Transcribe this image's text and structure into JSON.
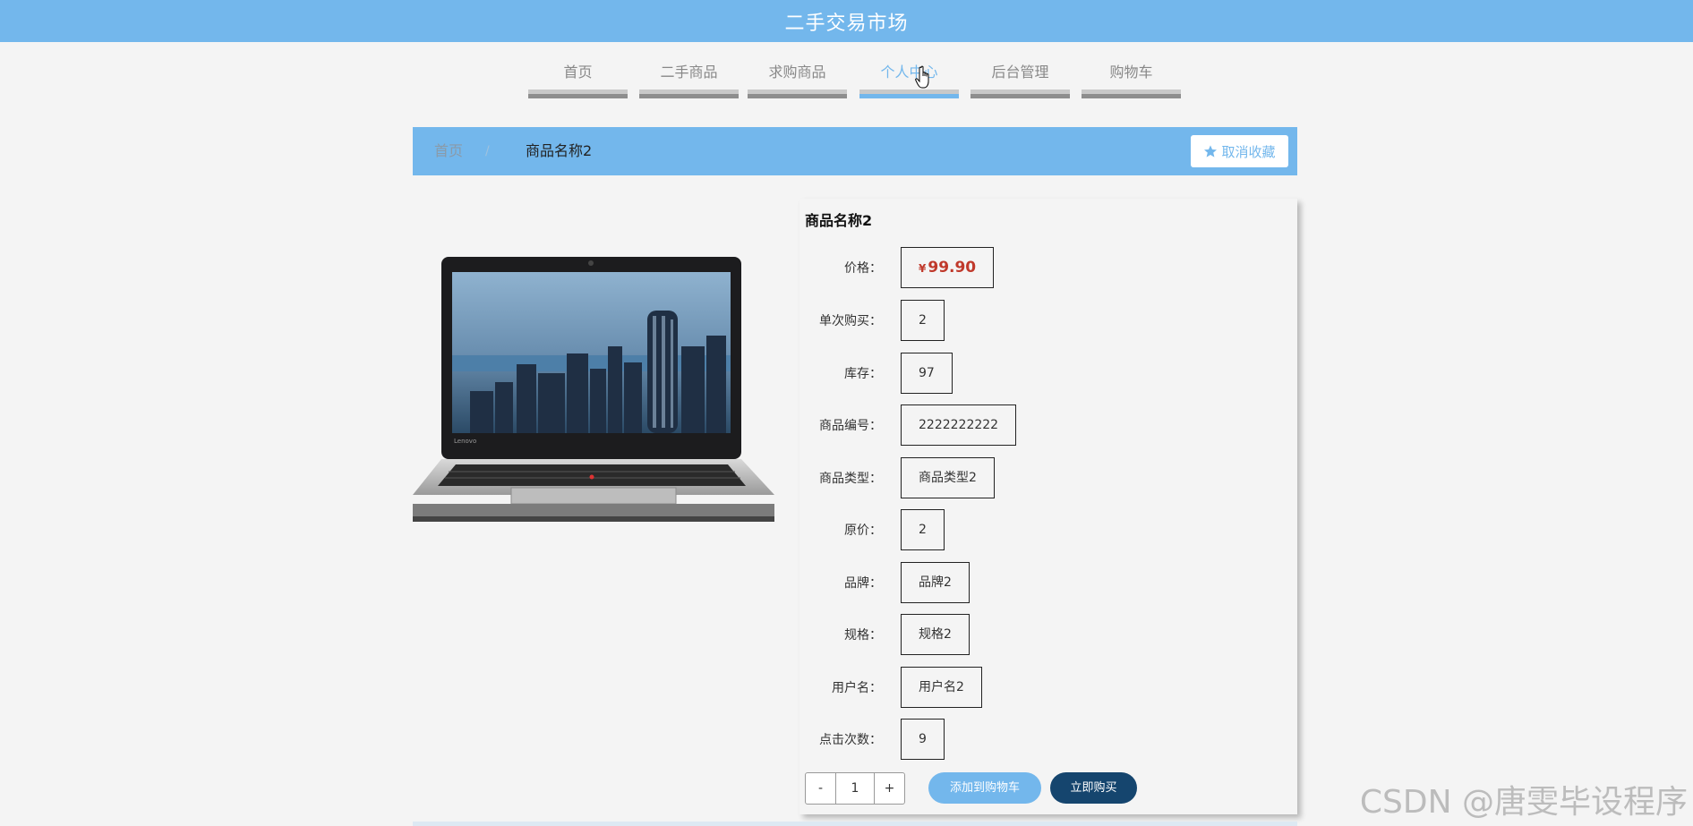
{
  "header": {
    "title": "二手交易市场"
  },
  "nav": {
    "items": [
      {
        "label": "首页",
        "active": false
      },
      {
        "label": "二手商品",
        "active": false
      },
      {
        "label": "求购商品",
        "active": false
      },
      {
        "label": "个人中心",
        "active": true
      },
      {
        "label": "后台管理",
        "active": false
      },
      {
        "label": "购物车",
        "active": false
      }
    ]
  },
  "breadcrumb": {
    "home": "首页",
    "separator": "/",
    "current": "商品名称2",
    "favorite_button": "取消收藏",
    "favorite_icon": "star-icon"
  },
  "product": {
    "name": "商品名称2",
    "image_alt": "laptop-image",
    "currency_symbol": "¥",
    "fields": [
      {
        "label": "价格：",
        "value": "99.90"
      },
      {
        "label": "单次购买：",
        "value": "2"
      },
      {
        "label": "库存：",
        "value": "97"
      },
      {
        "label": "商品编号：",
        "value": "2222222222"
      },
      {
        "label": "商品类型：",
        "value": "商品类型2"
      },
      {
        "label": "原价：",
        "value": "2"
      },
      {
        "label": "品牌：",
        "value": "品牌2"
      },
      {
        "label": "规格：",
        "value": "规格2"
      },
      {
        "label": "用户名：",
        "value": "用户名2"
      },
      {
        "label": "点击次数：",
        "value": "9"
      }
    ]
  },
  "purchase": {
    "minus_label": "-",
    "plus_label": "+",
    "quantity": "1",
    "add_to_cart_label": "添加到购物车",
    "buy_now_label": "立即购买"
  },
  "watermark": "CSDN @唐雯毕设程序",
  "colors": {
    "primary": "#73b7ec",
    "dark_button": "#15456e",
    "price": "#c0392b",
    "background": "#f4f4f4"
  }
}
